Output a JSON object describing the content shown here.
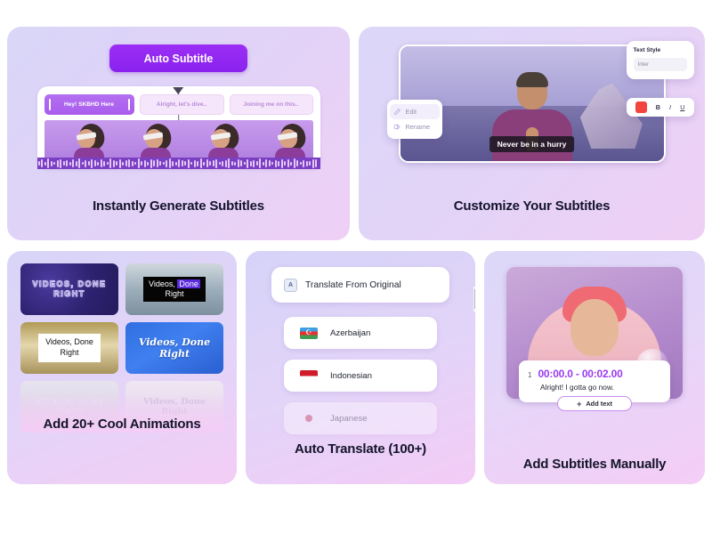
{
  "cards": [
    {
      "title": "Instantly Generate Subtitles",
      "button": "Auto Subtitle",
      "chips": [
        "Hey! SKBHD Here",
        "Alright, let's dive..",
        "Joining me on this.."
      ]
    },
    {
      "title": "Customize Your Subtitles",
      "caption": "Never be in a hurry",
      "style_panel": {
        "label": "Text Style",
        "font_value": "Inter",
        "swatch_color": "#f2453d"
      },
      "format_buttons": [
        "B",
        "I",
        "U"
      ],
      "context_menu": [
        "Edit",
        "Rename"
      ]
    },
    {
      "title": "Add 20+ Cool Animations",
      "thumbnails": [
        {
          "line1": "VIDEOS, DONE",
          "line2": "RIGHT"
        },
        {
          "line1": "Videos,",
          "highlight": "Done",
          "line2": "Right"
        },
        {
          "line1": "Videos, Done",
          "line2": "Right"
        },
        {
          "line1": "Videos, Done",
          "line2": "Right"
        },
        {
          "line1": "VIDEOS, DONE",
          "line2": "RIGHT"
        },
        {
          "line1": "Videos, Done",
          "line2": "Right"
        }
      ]
    },
    {
      "title": "Auto Translate (100+)",
      "header_button": "Translate From Original",
      "header_icon": "translate-icon",
      "languages": [
        {
          "name": "Azerbaijan",
          "flag": "flag-azerbaijan"
        },
        {
          "name": "Indonesian",
          "flag": "flag-indonesia"
        },
        {
          "name": "Japanese",
          "flag": "flag-japan"
        }
      ]
    },
    {
      "title": "Add Subtitles Manually",
      "subtitle_index": "1",
      "timestamp": "00:00.0 - 00:02.00",
      "subtitle_text": "Alright! I gotta go now.",
      "add_button": "Add text"
    }
  ]
}
